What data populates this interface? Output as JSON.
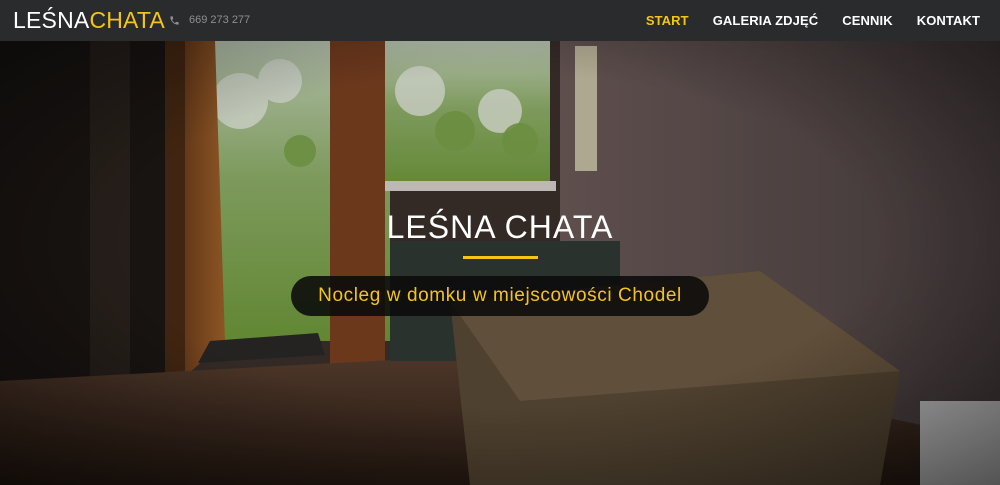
{
  "brand": {
    "part1": "LEŚNA",
    "part2": "CHATA"
  },
  "phone": {
    "icon": "phone-icon",
    "number": "669 273 277"
  },
  "menu": {
    "items": [
      {
        "label": "START",
        "active": true
      },
      {
        "label": "GALERIA ZDJĘĆ",
        "active": false
      },
      {
        "label": "CENNIK",
        "active": false
      },
      {
        "label": "KONTAKT",
        "active": false
      }
    ]
  },
  "hero": {
    "title": "LEŚNA CHATA",
    "subtitle": "Nocleg w domku w miejscowości Chodel"
  },
  "colors": {
    "accent": "#f4c517",
    "nav_bg": "#2a2b2d",
    "text": "#ffffff",
    "muted": "#8e8f91"
  }
}
